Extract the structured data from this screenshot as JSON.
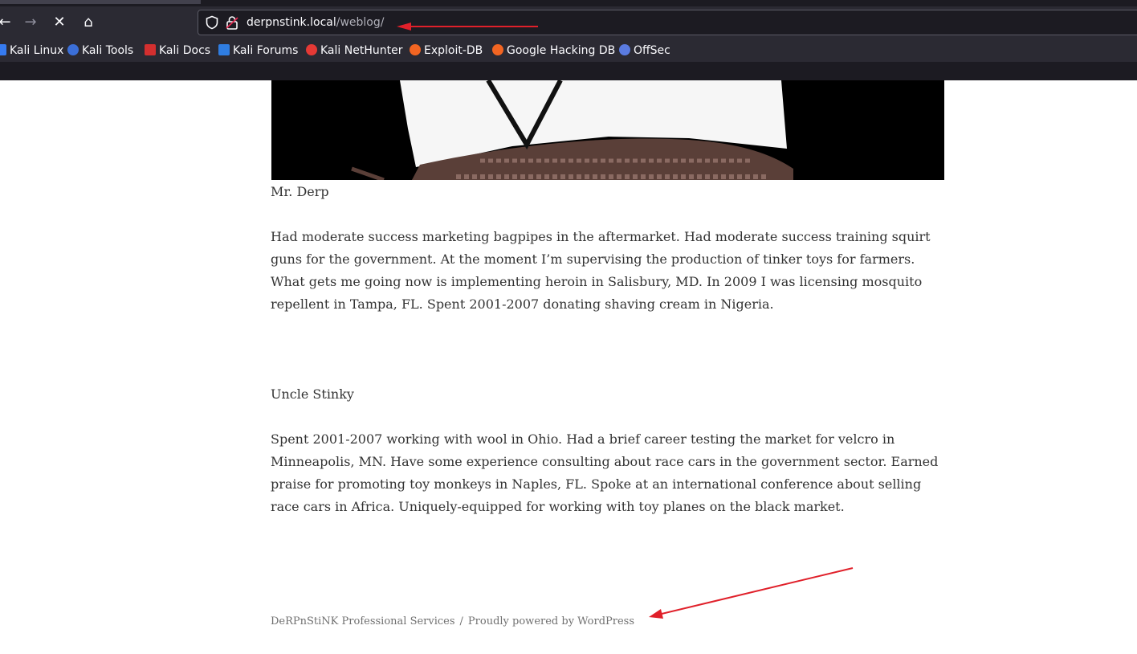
{
  "browser": {
    "url_domain": "derpnstink.local",
    "url_path": "/weblog/",
    "bookmarks": [
      {
        "label": "Kali Linux",
        "icon": "kali-linux-icon",
        "color": "#367bf0"
      },
      {
        "label": "Kali Tools",
        "icon": "kali-tools-icon",
        "color": "#3b6fd8"
      },
      {
        "label": "Kali Docs",
        "icon": "kali-docs-icon",
        "color": "#d32f2f"
      },
      {
        "label": "Kali Forums",
        "icon": "kali-forums-icon",
        "color": "#2f7de1"
      },
      {
        "label": "Kali NetHunter",
        "icon": "kali-nethunter-icon",
        "color": "#e53935"
      },
      {
        "label": "Exploit-DB",
        "icon": "exploit-db-icon",
        "color": "#f26522"
      },
      {
        "label": "Google Hacking DB",
        "icon": "ghdb-icon",
        "color": "#f26522"
      },
      {
        "label": "OffSec",
        "icon": "offsec-icon",
        "color": "#5a7be0"
      }
    ]
  },
  "post": {
    "caption1": "Mr. Derp",
    "bio1": "Had moderate success marketing bagpipes in the aftermarket. Had moderate success training squirt guns for the government. At the moment I’m supervising the production of tinker toys for farmers. What gets me going now is implementing heroin in Salisbury, MD. In 2009 I was licensing mosquito repellent in Tampa, FL. Spent 2001-2007 donating shaving cream in Nigeria.",
    "caption2": "Uncle Stinky",
    "bio2": "Spent 2001-2007 working with wool in Ohio. Had a brief career testing the market for velcro in Minneapolis, MN. Have some experience consulting about race cars in the government sector. Earned praise for promoting toy monkeys in Naples, FL. Spoke at an international conference about selling race cars in Africa. Uniquely-equipped for working with toy planes on the black market."
  },
  "footer": {
    "site_name": "DeRPnStiNK Professional Services",
    "separator": "/",
    "powered": "Proudly powered by WordPress"
  },
  "annotation_color": "#e0202a"
}
